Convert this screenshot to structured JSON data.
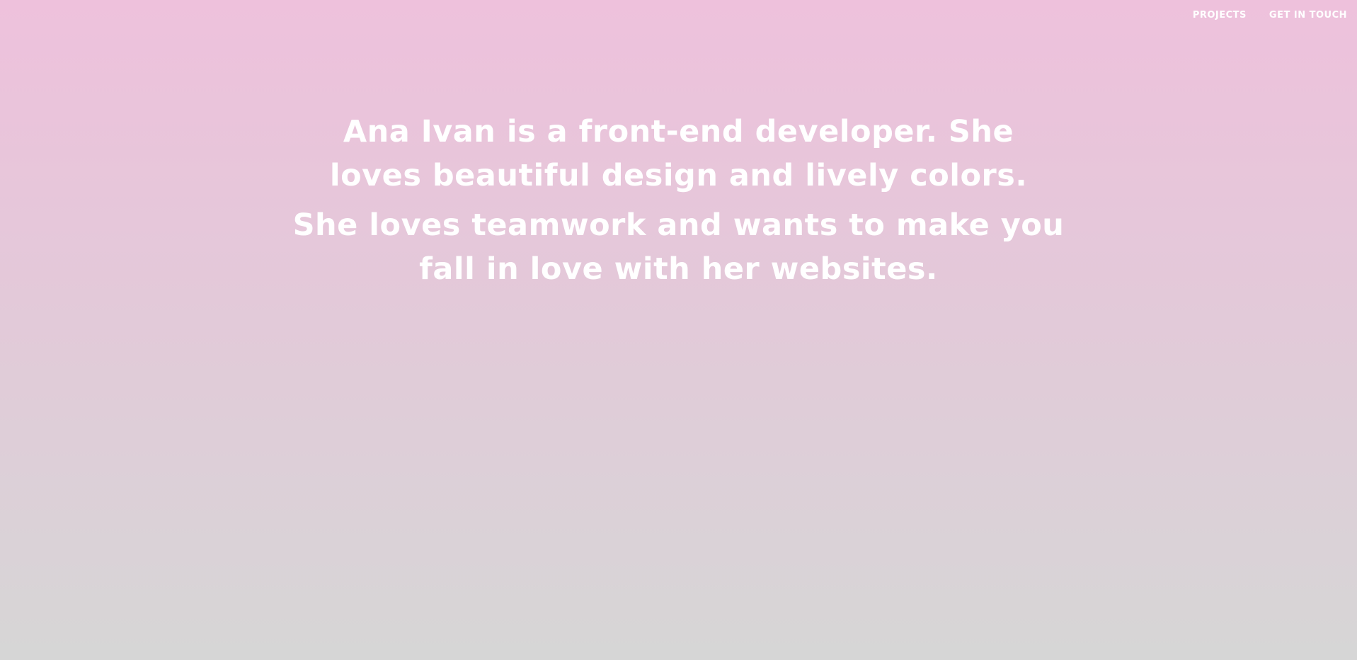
{
  "nav": {
    "items": [
      {
        "label": "PROJECTS"
      },
      {
        "label": "GET IN TOUCH"
      }
    ]
  },
  "hero": {
    "intro": "Ana Ivan is a front-end developer. She loves beautiful design and lively colors.",
    "passion": "She loves teamwork and wants to make you fall in love with her websites."
  },
  "colors": {
    "gradient_top": "#eec1dc",
    "gradient_bottom": "#d6d6d6",
    "text": "#ffffff"
  }
}
